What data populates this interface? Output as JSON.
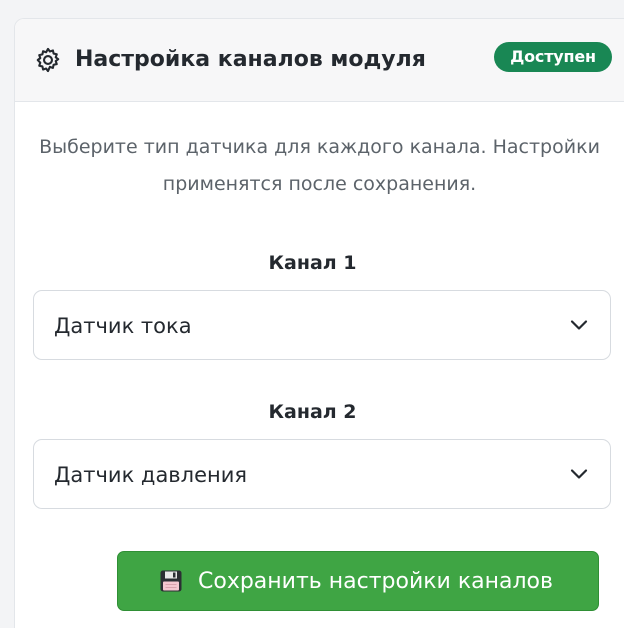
{
  "header": {
    "icon": "gear-icon",
    "title": "Настройка каналов модуля",
    "status_badge": "Доступен"
  },
  "description": {
    "line1": "Выберите тип датчика для каждого канала. Настройки",
    "line2": "применятся после сохранения."
  },
  "channels": [
    {
      "label": "Канал 1",
      "selected": "Датчик тока",
      "icon": "chevron-down-icon"
    },
    {
      "label": "Канал 2",
      "selected": "Датчик давления",
      "icon": "chevron-down-icon"
    }
  ],
  "save_button": {
    "icon": "floppy-disk-icon",
    "label": "Сохранить настройки каналов"
  },
  "colors": {
    "badge": "#198754",
    "button": "#3fa544",
    "header_bg": "#f7f7f8"
  }
}
